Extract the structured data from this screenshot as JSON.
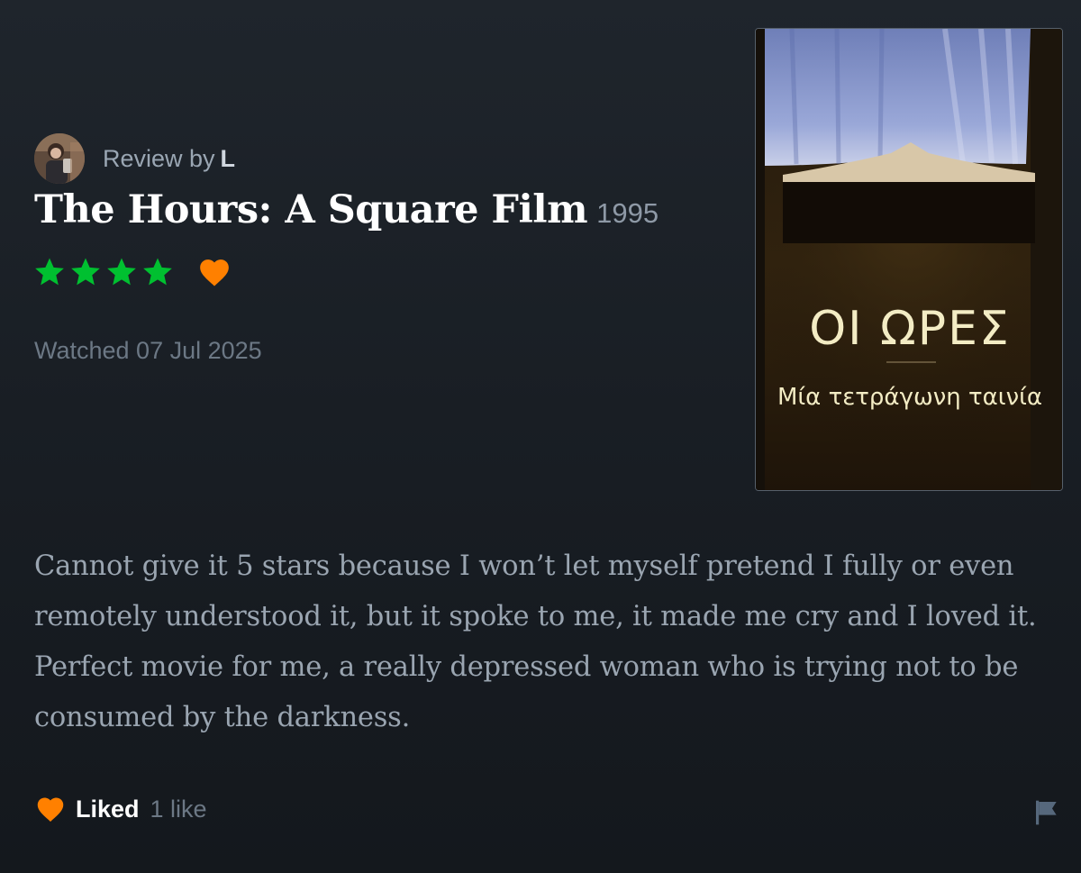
{
  "review": {
    "by_label": "Review by",
    "author": "L",
    "film_title": "The Hours: A Square Film",
    "year": "1995",
    "rating_stars": 4,
    "liked": true,
    "watched_text": "Watched 07 Jul 2025",
    "body": "Cannot give it 5 stars because I won’t let myself pretend I fully or even remotely understood it, but it spoke to me, it made me cry and I loved it. Perfect movie for me, a really depressed woman who is trying not to be consumed by the darkness."
  },
  "poster": {
    "title": "ΟΙ ΩΡΕΣ",
    "subtitle": "Μία τετράγωνη ταινία"
  },
  "footer": {
    "liked_label": "Liked",
    "like_count": "1 like"
  },
  "icons": {
    "star": "star-icon",
    "heart": "heart-icon",
    "flag": "flag-icon"
  },
  "colors": {
    "star": "#00c030",
    "heart": "#ff8000",
    "background": "#1a1f25",
    "flag": "#56687c"
  }
}
